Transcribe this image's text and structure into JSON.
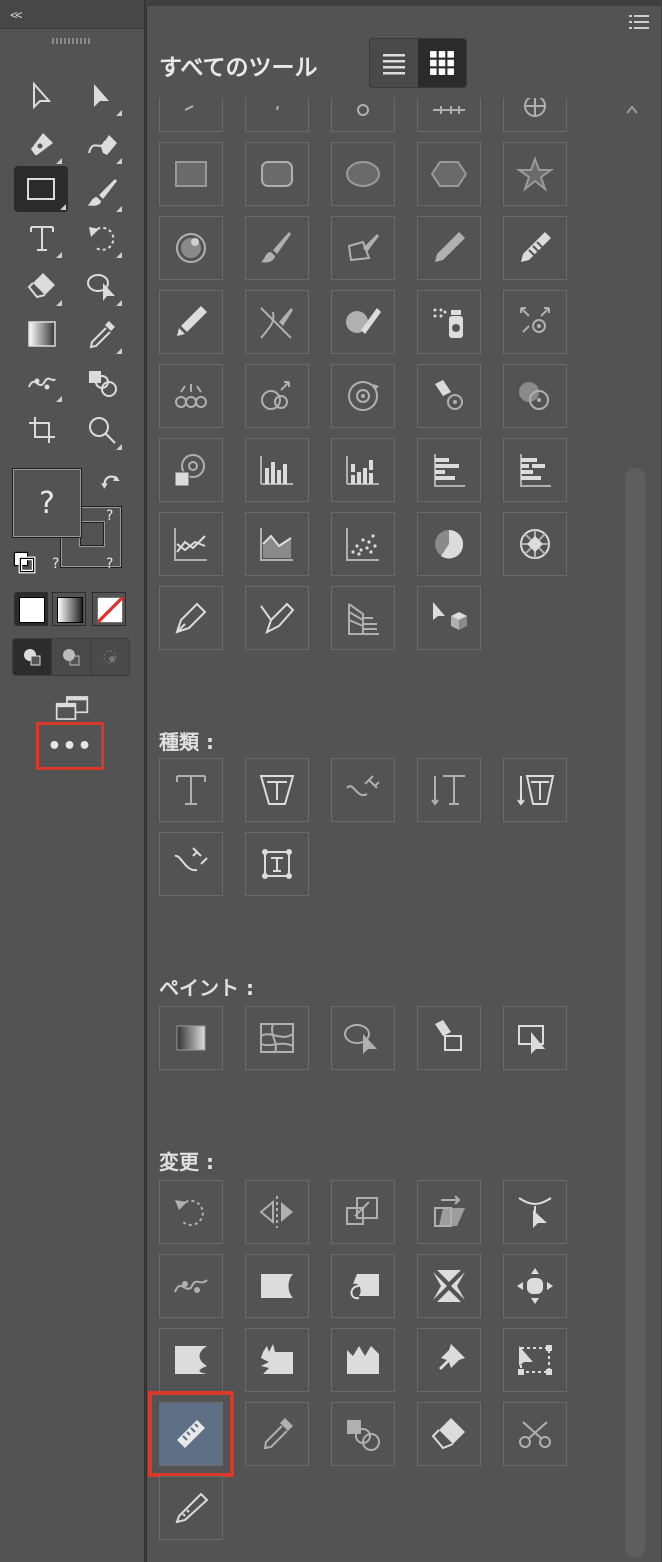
{
  "toolbar": {
    "collapse_label": "<<",
    "more_label": "•••",
    "tools": [
      "selection-icon",
      "direct-selection-icon",
      "pen-icon",
      "curvature-icon",
      "rectangle-icon",
      "paintbrush-icon",
      "type-icon",
      "rotate-icon",
      "eraser-icon",
      "shape-builder-icon",
      "gradient-icon",
      "eyedropper-icon",
      "puppet-warp-icon",
      "blend-icon",
      "artboard-icon",
      "zoom-icon"
    ],
    "fill_label": "?",
    "stroke_label_1": "?",
    "stroke_label_2": "?",
    "stroke_label_3": "?"
  },
  "panel": {
    "title": "すべてのツール",
    "sections": {
      "type": "種類 :",
      "paint": "ペイント :",
      "modify": "変更 :"
    },
    "accent_color": "#d9392b",
    "selected_tool_color": "#5f6f86"
  }
}
